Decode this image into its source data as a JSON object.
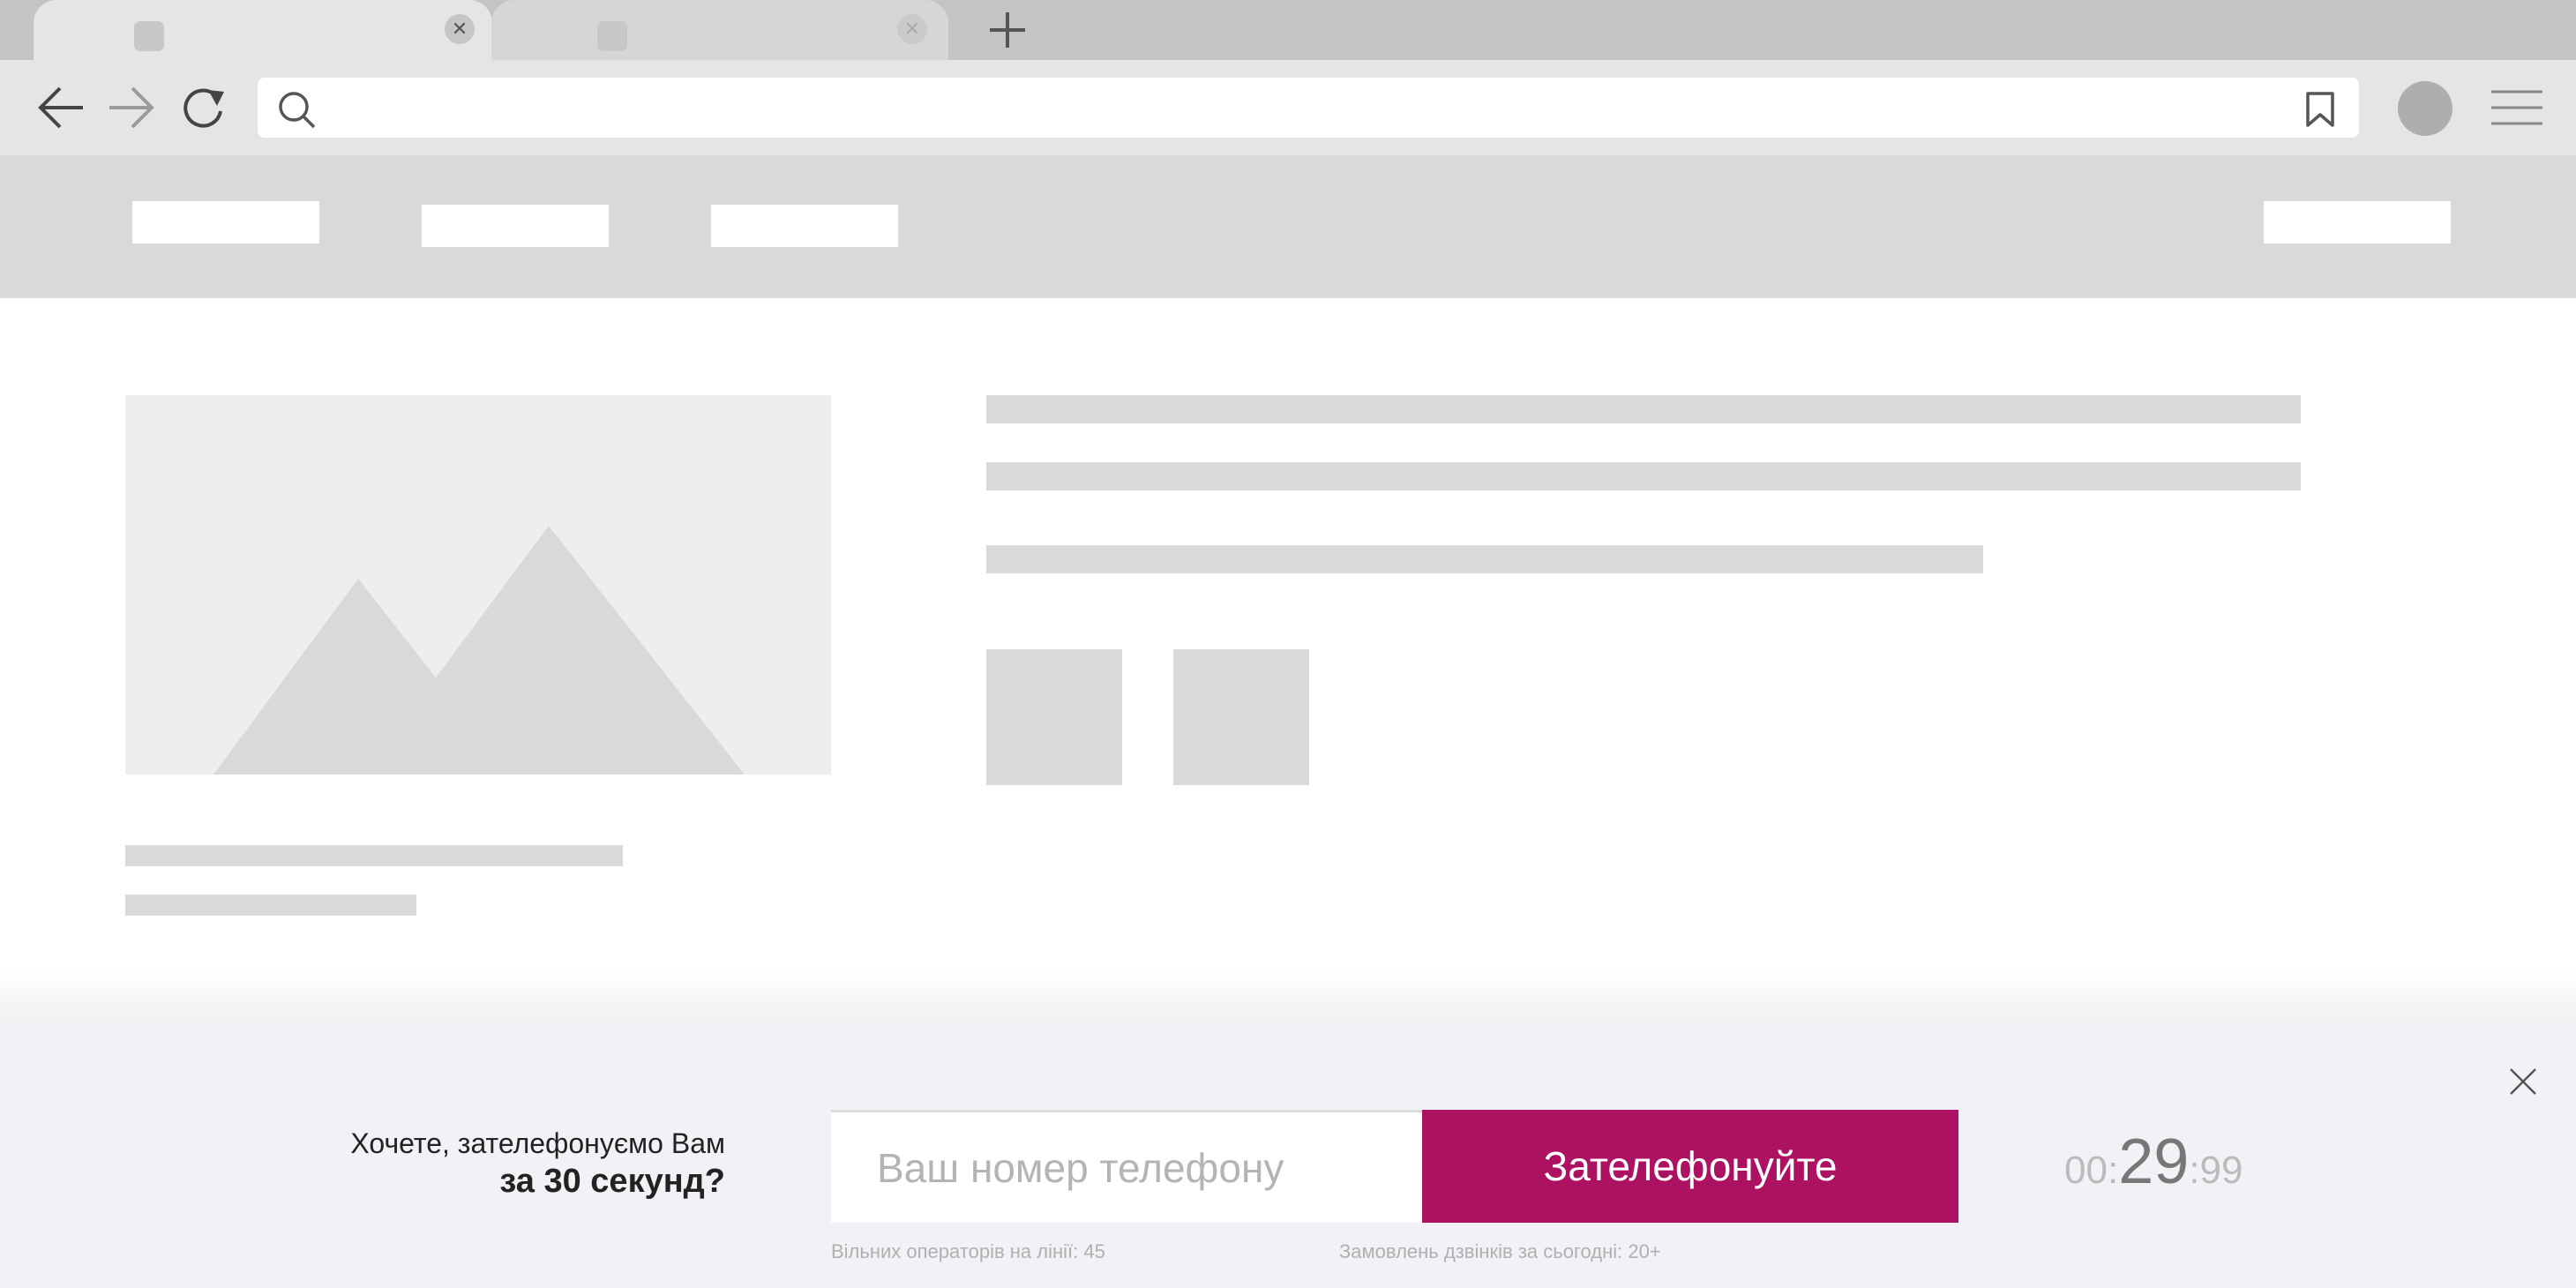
{
  "browser": {
    "tabs": [
      {
        "favicon": "favicon-placeholder-icon",
        "close_icon": "close-icon",
        "close_glyph": "✕",
        "active": true
      },
      {
        "favicon": "favicon-placeholder-icon",
        "close_icon": "close-icon",
        "close_glyph": "✕",
        "active": false
      }
    ],
    "toolbar": {
      "icons": [
        "back-arrow-icon",
        "forward-arrow-icon",
        "reload-icon",
        "search-icon",
        "bookmark-icon",
        "avatar",
        "hamburger-menu-icon",
        "plus-icon"
      ],
      "address_value": ""
    }
  },
  "widget": {
    "question_line1": "Хочете, зателефонуємо Вам",
    "question_line2": "за 30 секунд?",
    "phone_placeholder": "Ваш номер телефону",
    "call_button_label": "Зателефонуйте",
    "timer": {
      "minutes": "00",
      "sep1": ":",
      "seconds": "29",
      "sep2": ":",
      "hundredths": "99"
    },
    "operators_text": "Вільних операторів на лінії: 45",
    "orders_text": "Замовлень дзвінків за сьогодні: 20+",
    "close_icon": "close-icon"
  },
  "colors": {
    "accent": "#ad1162",
    "tab_strip": "#c4c4c4",
    "toolbar": "#e5e5e5",
    "site_header": "#d9d9d9",
    "widget_background": "#f2f1f5",
    "placeholder_gray": "#d9d9d9"
  }
}
